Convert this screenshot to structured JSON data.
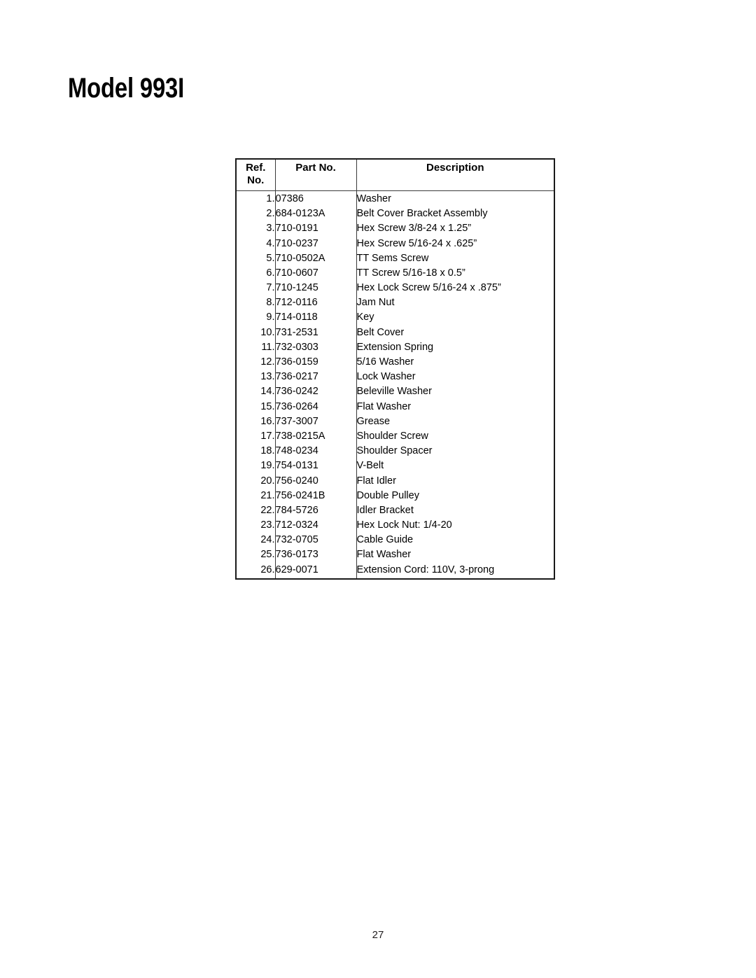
{
  "document": {
    "title": "Model 993I",
    "page_number": "27"
  },
  "table": {
    "headers": {
      "ref_no_line1": "Ref.",
      "ref_no_line2": "No.",
      "part_no": "Part No.",
      "description": "Description"
    },
    "rows": [
      {
        "ref": "1.",
        "part": "07386",
        "description": "Washer"
      },
      {
        "ref": "2.",
        "part": "684-0123A",
        "description": "Belt Cover Bracket Assembly"
      },
      {
        "ref": "3.",
        "part": "710-0191",
        "description": "Hex Screw 3/8-24 x 1.25”"
      },
      {
        "ref": "4.",
        "part": "710-0237",
        "description": "Hex Screw 5/16-24 x .625”"
      },
      {
        "ref": "5.",
        "part": "710-0502A",
        "description": "TT Sems Screw"
      },
      {
        "ref": "6.",
        "part": "710-0607",
        "description": "TT Screw 5/16-18 x 0.5”"
      },
      {
        "ref": "7.",
        "part": "710-1245",
        "description": "Hex Lock Screw 5/16-24 x .875”"
      },
      {
        "ref": "8.",
        "part": "712-0116",
        "description": "Jam Nut"
      },
      {
        "ref": "9.",
        "part": "714-0118",
        "description": "Key"
      },
      {
        "ref": "10.",
        "part": "731-2531",
        "description": "Belt Cover"
      },
      {
        "ref": "11.",
        "part": "732-0303",
        "description": "Extension Spring"
      },
      {
        "ref": "12.",
        "part": "736-0159",
        "description": "5/16 Washer"
      },
      {
        "ref": "13.",
        "part": "736-0217",
        "description": "Lock Washer"
      },
      {
        "ref": "14.",
        "part": "736-0242",
        "description": "Beleville Washer"
      },
      {
        "ref": "15.",
        "part": "736-0264",
        "description": "Flat Washer"
      },
      {
        "ref": "16.",
        "part": "737-3007",
        "description": "Grease"
      },
      {
        "ref": "17.",
        "part": "738-0215A",
        "description": "Shoulder Screw"
      },
      {
        "ref": "18.",
        "part": "748-0234",
        "description": "Shoulder Spacer"
      },
      {
        "ref": "19.",
        "part": "754-0131",
        "description": "V-Belt"
      },
      {
        "ref": "20.",
        "part": "756-0240",
        "description": "Flat Idler"
      },
      {
        "ref": "21.",
        "part": "756-0241B",
        "description": "Double Pulley"
      },
      {
        "ref": "22.",
        "part": "784-5726",
        "description": "Idler Bracket"
      },
      {
        "ref": "23.",
        "part": "712-0324",
        "description": "Hex Lock Nut: 1/4-20"
      },
      {
        "ref": "24.",
        "part": "732-0705",
        "description": "Cable Guide"
      },
      {
        "ref": "25.",
        "part": "736-0173",
        "description": "Flat Washer"
      },
      {
        "ref": "26.",
        "part": "629-0071",
        "description": "Extension Cord: 110V, 3-prong"
      }
    ]
  },
  "colors": {
    "text": "#000000",
    "border_outer": "#1a1a1a",
    "border_inner": "#3a3a3a",
    "page_background": "#ffffff"
  }
}
